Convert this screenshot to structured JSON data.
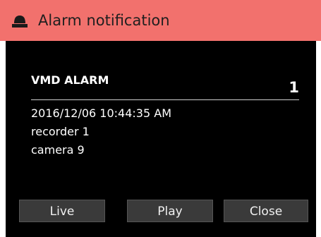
{
  "window": {
    "title": "Alarm notification",
    "title_icon": "alarm-light-icon",
    "title_bar_color": "#f2716d"
  },
  "alarm": {
    "type": "VMD ALARM",
    "count": "1",
    "datetime": "2016/12/06 10:44:35 AM",
    "recorder": "recorder 1",
    "camera": "camera 9"
  },
  "buttons": {
    "live": "Live",
    "play": "Play",
    "close": "Close"
  }
}
